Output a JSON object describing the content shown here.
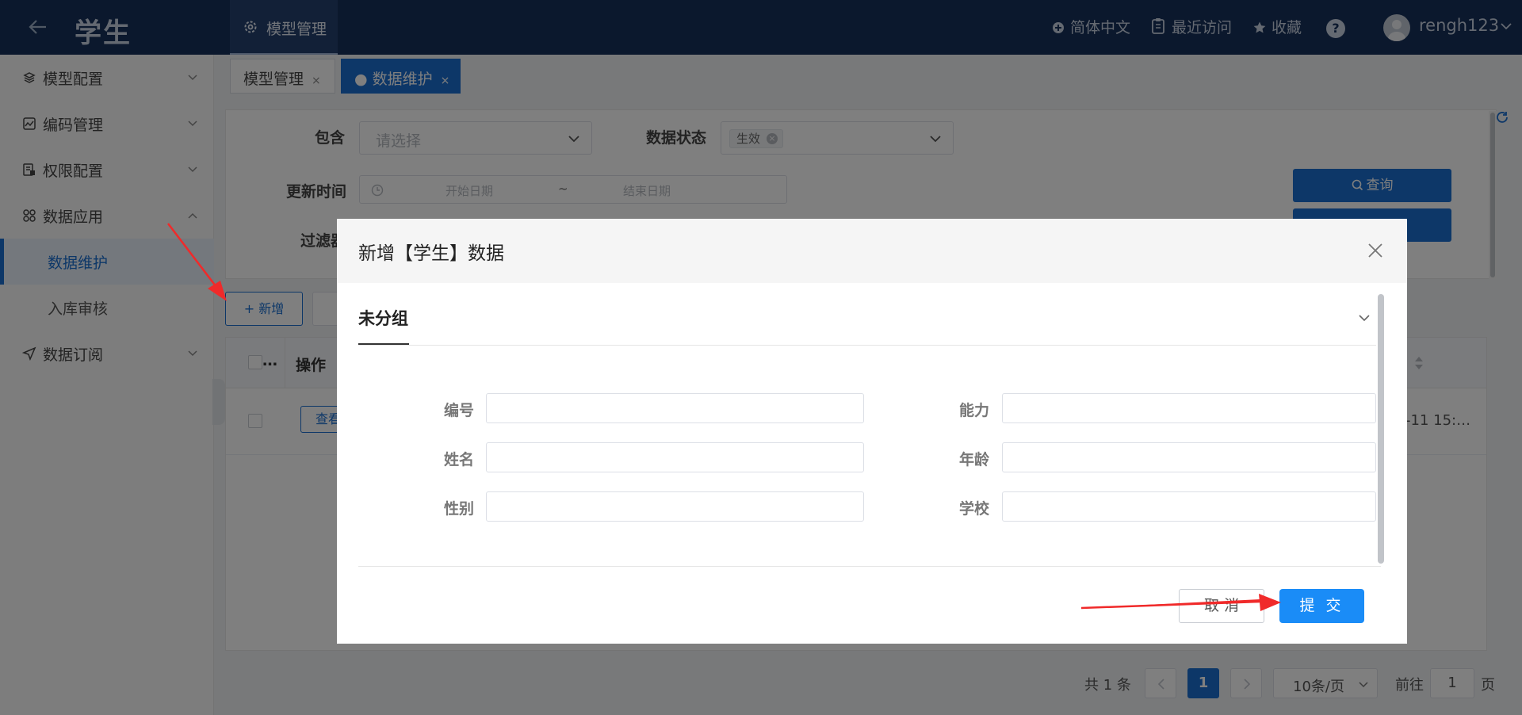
{
  "header": {
    "app_title": "学生",
    "top_tab": "模型管理",
    "language": "简体中文",
    "recent": "最近访问",
    "favorites": "收藏",
    "help": "?",
    "username": "rengh123"
  },
  "sidebar": {
    "items": [
      {
        "label": "模型配置"
      },
      {
        "label": "编码管理"
      },
      {
        "label": "权限配置"
      },
      {
        "label": "数据应用"
      },
      {
        "label": "数据订阅"
      }
    ],
    "sub_items": [
      {
        "label": "数据维护"
      },
      {
        "label": "入库审核"
      }
    ]
  },
  "page_tabs": {
    "tab1": "模型管理",
    "tab2": "● 数据维护",
    "close": "×"
  },
  "filter": {
    "contains_label": "包含",
    "contains_placeholder": "请选择",
    "status_label": "数据状态",
    "status_tag": "生效",
    "tag_close": "×",
    "update_time_label": "更新时间",
    "start_date": "开始日期",
    "date_sep": "~",
    "end_date": "结束日期",
    "filter_label": "过滤器",
    "query_button": "查询"
  },
  "toolbar": {
    "add_button": "+ 新增"
  },
  "table": {
    "header_check_more": "…",
    "col_operation": "操作",
    "row_view_button": "查看",
    "row_time": "-11 15:…"
  },
  "pager": {
    "total": "共 1 条",
    "current_page": "1",
    "page_size": "10条/页",
    "goto_label": "前往",
    "goto_value": "1",
    "page_suffix": "页"
  },
  "modal": {
    "title": "新增【学生】数据",
    "group": "未分组",
    "fields_left": [
      {
        "label": "编号",
        "value": ""
      },
      {
        "label": "姓名",
        "value": ""
      },
      {
        "label": "性别",
        "value": ""
      }
    ],
    "fields_right": [
      {
        "label": "能力",
        "value": ""
      },
      {
        "label": "年龄",
        "value": ""
      },
      {
        "label": "学校",
        "value": ""
      }
    ],
    "cancel": "取 消",
    "submit": "提 交"
  },
  "colors": {
    "header_bg": "#16305a",
    "primary": "#1a6fd1",
    "submit": "#1a8cf7",
    "annotation_arrow": "#f02a2a"
  }
}
